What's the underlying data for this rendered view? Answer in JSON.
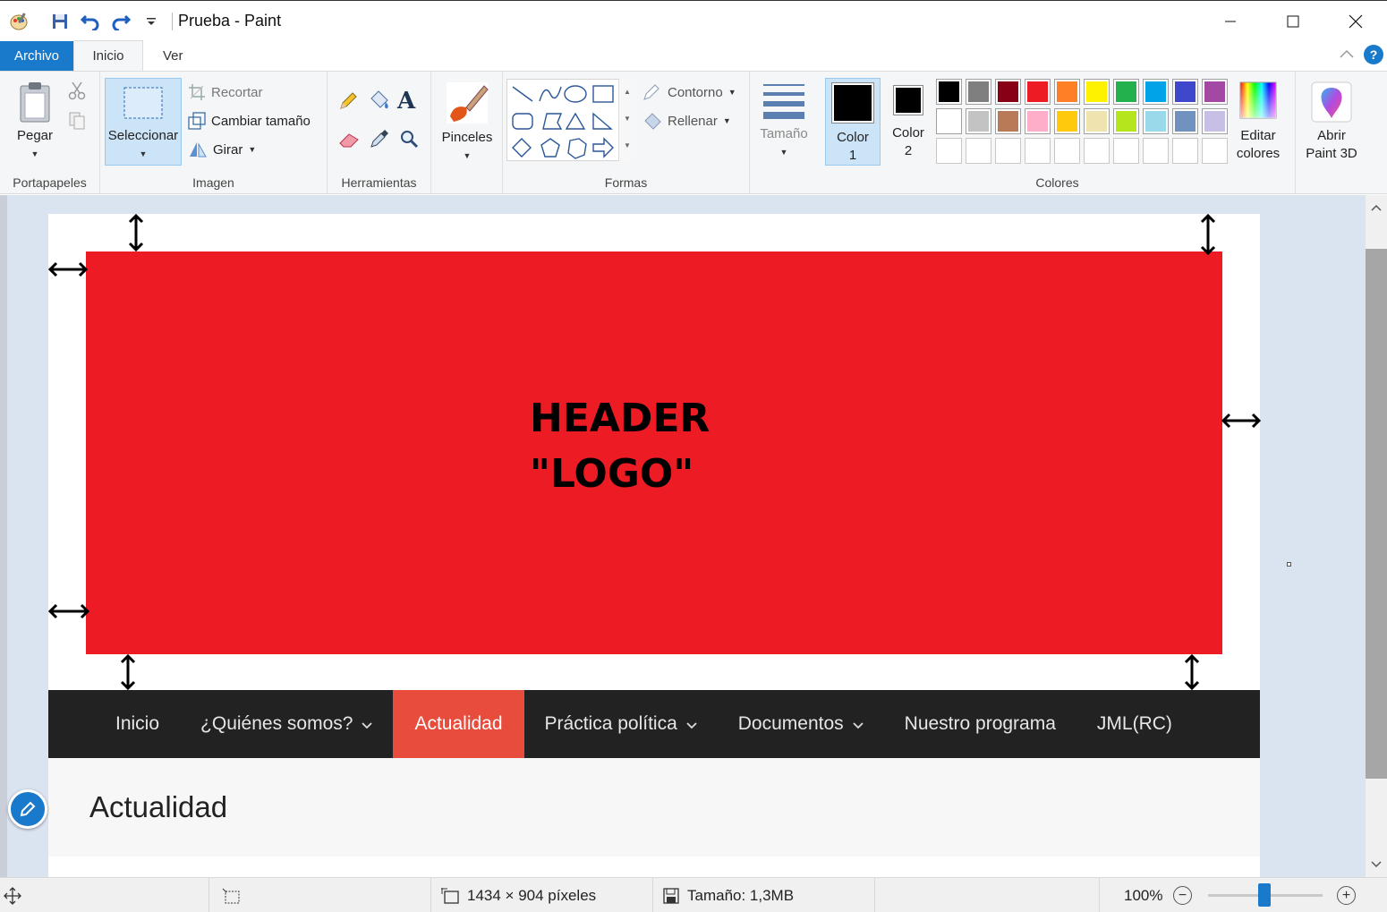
{
  "window": {
    "title": "Prueba - Paint"
  },
  "tabs": {
    "file": "Archivo",
    "home": "Inicio",
    "view": "Ver"
  },
  "ribbon": {
    "clipboard": {
      "paste": "Pegar",
      "group": "Portapapeles"
    },
    "image": {
      "select": "Seleccionar",
      "crop": "Recortar",
      "resize": "Cambiar tamaño",
      "rotate": "Girar",
      "group": "Imagen"
    },
    "tools": {
      "group": "Herramientas"
    },
    "brushes": {
      "label": "Pinceles"
    },
    "shapes": {
      "outline": "Contorno",
      "fill": "Rellenar",
      "group": "Formas"
    },
    "size": {
      "label": "Tamaño"
    },
    "colors": {
      "color1_line1": "Color",
      "color1_line2": "1",
      "color2_line1": "Color",
      "color2_line2": "2",
      "edit_line1": "Editar",
      "edit_line2": "colores",
      "paint3d_line1": "Abrir",
      "paint3d_line2": "Paint 3D",
      "group": "Colores",
      "color1": "#000000",
      "color2": "#000000",
      "palette_row1": [
        "#000000",
        "#7f7f7f",
        "#880015",
        "#ed1c24",
        "#ff7f27",
        "#fff200",
        "#22b14c",
        "#00a2e8",
        "#3f48cc",
        "#a349a4"
      ],
      "palette_row2": [
        "#ffffff",
        "#c3c3c3",
        "#b97a57",
        "#ffaec9",
        "#ffc90e",
        "#efe4b0",
        "#b5e61d",
        "#99d9ea",
        "#7092be",
        "#c8bfe7"
      ],
      "palette_row3": [
        "#ffffff",
        "#ffffff",
        "#ffffff",
        "#ffffff",
        "#ffffff",
        "#ffffff",
        "#ffffff",
        "#ffffff",
        "#ffffff",
        "#ffffff"
      ]
    }
  },
  "canvas": {
    "header_line1": "HEADER",
    "header_line2": "\"LOGO\"",
    "header_color": "#ed1c24",
    "nav": {
      "items": [
        {
          "label": "Inicio",
          "dropdown": false,
          "active": false
        },
        {
          "label": "¿Quiénes somos?",
          "dropdown": true,
          "active": false
        },
        {
          "label": "Actualidad",
          "dropdown": false,
          "active": true
        },
        {
          "label": "Práctica política",
          "dropdown": true,
          "active": false
        },
        {
          "label": "Documentos",
          "dropdown": true,
          "active": false
        },
        {
          "label": "Nuestro programa",
          "dropdown": false,
          "active": false
        },
        {
          "label": "JML(RC)",
          "dropdown": false,
          "active": false
        }
      ],
      "active_color": "#e74c3c",
      "bar_color": "#222222"
    },
    "page_heading": "Actualidad"
  },
  "statusbar": {
    "dimensions": "1434 × 904 píxeles",
    "filesize": "Tamaño: 1,3MB",
    "zoom": "100%",
    "zoom_level": 1.0
  }
}
